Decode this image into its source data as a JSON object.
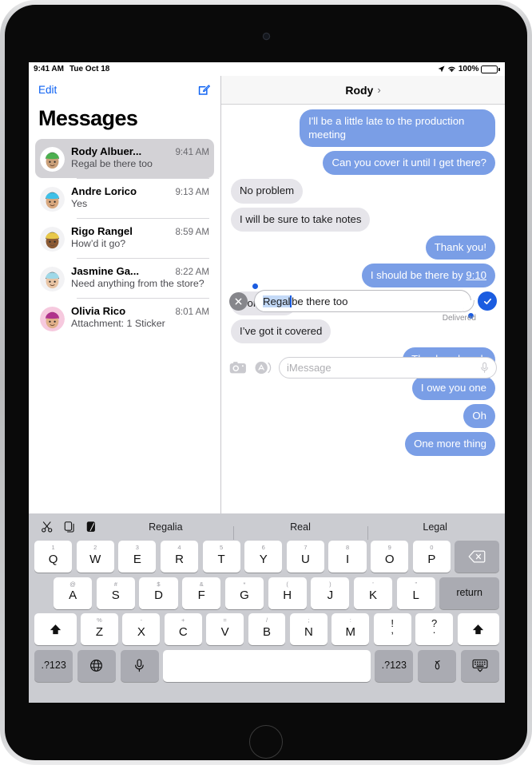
{
  "status_bar": {
    "time": "9:41 AM",
    "date": "Tue Oct 18",
    "battery_percent": "100%",
    "location_icon": "location-arrow-icon",
    "wifi_icon": "wifi-icon",
    "battery_icon": "battery-full-icon"
  },
  "sidebar": {
    "edit_label": "Edit",
    "compose_icon": "compose-square-pencil-icon",
    "title": "Messages",
    "conversations": [
      {
        "name": "Rody Albuer...",
        "time": "9:41 AM",
        "preview": "Regal be there too",
        "selected": true,
        "avatar_hat": "#4caf50",
        "avatar_skin": "#caa07a",
        "avatar_hair": "#2c2c2c",
        "avatar_bg": "#ffffff"
      },
      {
        "name": "Andre Lorico",
        "time": "9:13 AM",
        "preview": "Yes",
        "selected": false,
        "avatar_hat": "#3ec0e8",
        "avatar_skin": "#d8a87f",
        "avatar_hair": "#2b1a14",
        "avatar_bg": "#f2f2f4"
      },
      {
        "name": "Rigo Rangel",
        "time": "8:59 AM",
        "preview": "How’d it go?",
        "selected": false,
        "avatar_hat": "#e8c84a",
        "avatar_skin": "#8b5a34",
        "avatar_hair": "#16120f",
        "avatar_bg": "#f2f2f4"
      },
      {
        "name": "Jasmine Ga...",
        "time": "8:22 AM",
        "preview": "Need anything from the store?",
        "selected": false,
        "avatar_hat": "#9ed8e8",
        "avatar_skin": "#e8c4a4",
        "avatar_hair": "#1a1a1a",
        "avatar_bg": "#f2f2f4"
      },
      {
        "name": "Olivia Rico",
        "time": "8:01 AM",
        "preview": "Attachment: 1 Sticker",
        "selected": false,
        "avatar_hat": "#b0338c",
        "avatar_skin": "#e0b08a",
        "avatar_hair": "#8e2a6e",
        "avatar_bg": "#f6c9de"
      }
    ]
  },
  "conversation": {
    "title": "Rody",
    "chevron": "›",
    "messages": [
      {
        "text": "I'll be a little late to the production meeting",
        "side": "out",
        "tail": true
      },
      {
        "text": "Can you cover it until I get there?",
        "side": "out",
        "tail": true
      },
      {
        "text": "No problem",
        "side": "in",
        "tail": false
      },
      {
        "text": "I will be sure to take notes",
        "side": "in",
        "tail": true
      },
      {
        "text": "Thank you!",
        "side": "out",
        "tail": false
      },
      {
        "text": "I should be there by 9:10",
        "side": "out",
        "tail": true,
        "link_suffix": "9:10"
      },
      {
        "text": "Don’t rush",
        "side": "in",
        "tail": false
      },
      {
        "text": "I’ve got it covered",
        "side": "in",
        "tail": true
      },
      {
        "text": "Thanks a bunch",
        "side": "out",
        "tail": false
      },
      {
        "text": "I owe you one",
        "side": "out",
        "tail": false
      },
      {
        "text": "Oh",
        "side": "out",
        "tail": false
      },
      {
        "text": "One more thing",
        "side": "out",
        "tail": true
      }
    ],
    "editing": {
      "cancel_icon": "close-x-icon",
      "selected_text": "Regal",
      "rest_text": " be there too",
      "full_text": "Regal be there too",
      "confirm_icon": "checkmark-icon",
      "status": "Delivered",
      "selection_color": "#c3d9f7",
      "handle_color": "#1b5ce0"
    },
    "compose": {
      "camera_icon": "camera-icon",
      "appstore_icon": "app-store-icon",
      "placeholder": "iMessage",
      "mic_icon": "microphone-icon"
    }
  },
  "keyboard": {
    "toolbar": {
      "cut_icon": "scissors-icon",
      "copy_icon": "copy-icon",
      "paste_icon": "paste-icon",
      "suggestions": [
        "Regalia",
        "Real",
        "Legal"
      ]
    },
    "row1": [
      {
        "main": "Q",
        "alt": "1"
      },
      {
        "main": "W",
        "alt": "2"
      },
      {
        "main": "E",
        "alt": "3"
      },
      {
        "main": "R",
        "alt": "4"
      },
      {
        "main": "T",
        "alt": "5"
      },
      {
        "main": "Y",
        "alt": "6"
      },
      {
        "main": "U",
        "alt": "7"
      },
      {
        "main": "I",
        "alt": "8"
      },
      {
        "main": "O",
        "alt": "9"
      },
      {
        "main": "P",
        "alt": "0"
      }
    ],
    "delete_icon": "delete-backward-icon",
    "row2": [
      {
        "main": "A",
        "alt": "@"
      },
      {
        "main": "S",
        "alt": "#"
      },
      {
        "main": "D",
        "alt": "$"
      },
      {
        "main": "F",
        "alt": "&"
      },
      {
        "main": "G",
        "alt": "*"
      },
      {
        "main": "H",
        "alt": "("
      },
      {
        "main": "J",
        "alt": ")"
      },
      {
        "main": "K",
        "alt": "’"
      },
      {
        "main": "L",
        "alt": "”"
      }
    ],
    "return_label": "return",
    "row3": [
      {
        "main": "Z",
        "alt": "%"
      },
      {
        "main": "X",
        "alt": "-"
      },
      {
        "main": "C",
        "alt": "+"
      },
      {
        "main": "V",
        "alt": "="
      },
      {
        "main": "B",
        "alt": "/"
      },
      {
        "main": "N",
        "alt": ";"
      },
      {
        "main": "M",
        "alt": ":"
      }
    ],
    "punct1": {
      "alt": "!",
      "main": ","
    },
    "punct2": {
      "alt": "?",
      "main": "."
    },
    "shift_icon": "shift-arrow-icon",
    "row4": {
      "numbers_left": ".?123",
      "globe_icon": "globe-icon",
      "mic_icon": "microphone-icon",
      "space_label": "",
      "numbers_right": ".?123",
      "handwriting_icon": "handwriting-icon",
      "dismiss_icon": "dismiss-keyboard-icon"
    }
  },
  "colors": {
    "bubble_out": "#7a9ee6",
    "bubble_in": "#e6e5ea",
    "accent_blue": "#0b60f2",
    "selected_row": "#d3d2d6",
    "keyboard_bg": "#cbccd1"
  }
}
